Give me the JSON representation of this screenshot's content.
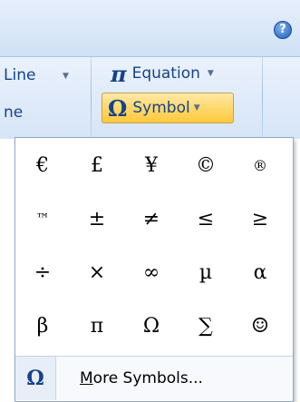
{
  "window": {
    "help_icon_glyph": "?"
  },
  "ribbon": {
    "line_label": "Line",
    "line2_label": "ne",
    "equation_label": "Equation",
    "equation_icon_glyph": "π",
    "symbol_label": "Symbol",
    "symbol_icon_glyph": "Ω",
    "dropdown_glyph": "▼"
  },
  "symbols": [
    [
      "€",
      "£",
      "¥",
      "©",
      "®"
    ],
    [
      "™",
      "±",
      "≠",
      "≤",
      "≥"
    ],
    [
      "÷",
      "×",
      "∞",
      "µ",
      "α"
    ],
    [
      "β",
      "π",
      "Ω",
      "∑",
      "☺"
    ]
  ],
  "more_symbols": {
    "icon_glyph": "Ω",
    "label_underlined": "M",
    "label_rest": "ore Symbols..."
  }
}
